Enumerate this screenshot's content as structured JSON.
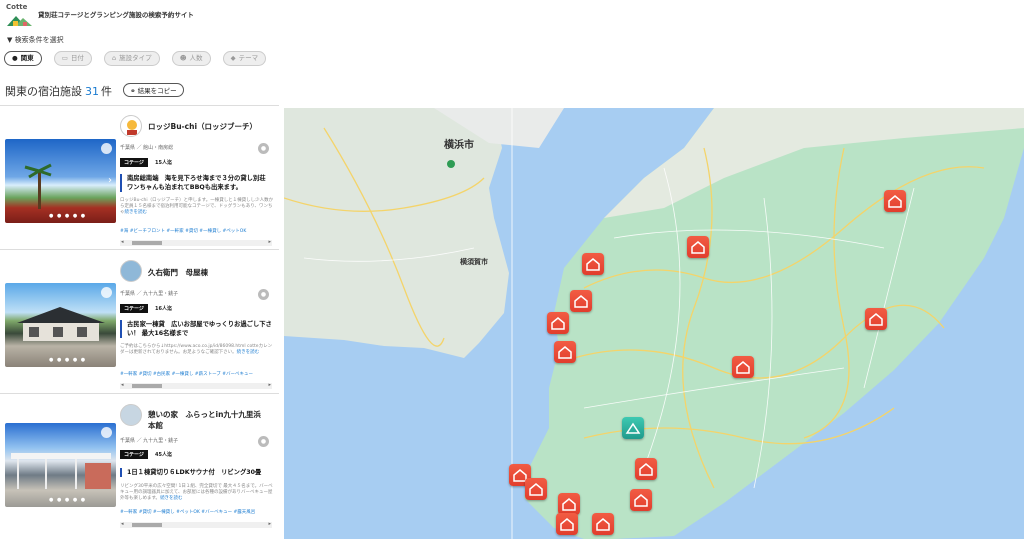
{
  "header": {
    "logo_text": "Cotte",
    "tagline": "貸別荘コテージとグランピング施設の検索予約サイト"
  },
  "filter_label": "検索条件を選択",
  "filters": [
    {
      "label": "関東",
      "icon": "location-pin-icon",
      "active": true
    },
    {
      "label": "日付",
      "icon": "calendar-icon",
      "active": false
    },
    {
      "label": "施設タイプ",
      "icon": "house-icon",
      "active": false
    },
    {
      "label": "人数",
      "icon": "people-icon",
      "active": false
    },
    {
      "label": "テーマ",
      "icon": "tag-icon",
      "active": false
    }
  ],
  "results": {
    "title": "関東の宿泊施設",
    "count": "31",
    "unit": "件",
    "copy_button": "結果をコピー"
  },
  "listings": [
    {
      "name": "ロッジBu-chi（ロッジブーチ）",
      "location": "千葉県 ／ 館山・南房総",
      "type": "コテージ",
      "capacity": "15人迄",
      "headline": "南房総南端　海を見下ろせ海まで３分の貸し別荘　ワンちゃんも泊まれてBBQも出来ます。",
      "description": "ロッジBu-chi（ロッジブーチ）と申します。一棟貸しと１棟貸しし少人数から定員１５名様まで宿泊利用可能なコテージで、ドッグランもあり、ワンちゃ",
      "more": "続きを読む",
      "tags": "#海 #ビーチフロント #一軒家 #貸切 #一棟貸し #ペットOK"
    },
    {
      "name": "久右衛門　母屋棟",
      "location": "千葉県 ／ 九十九里・銚子",
      "type": "コテージ",
      "capacity": "16人迄",
      "headline": "古民家一棟貸　広いお部屋でゆっくりお過ごし下さい！ 最大16名様まで",
      "description": "ご予約はこちらから↓https://www.aco.co.jp/id/86098.html cotteカレンダーは更新されておりません。お足ようなご確認下さい。",
      "more": "続きを読む",
      "tags": "#一軒家 #貸切 #古民家 #一棟貸し #薪ストーブ #バーベキュー"
    },
    {
      "name": "憩いの家　ふらっとin九十九里浜　本館",
      "location": "千葉県 ／ 九十九里・銚子",
      "type": "コテージ",
      "capacity": "45人迄",
      "headline": "1日１棟貸切り６LDKサウナ付　リビング30畳",
      "description": "リビング30平米の広々空間! 1日１組、完全貸切で 最大４５名まで。バーベキュー用の調理器具に加えて、お部屋には各種の設備がありバーベキュー屋外等も楽しめます。",
      "more": "続きを読む",
      "tags": "#一軒家 #貸切 #一棟貸し #ペットOK #バーベキュー #露天風呂"
    }
  ],
  "map": {
    "labels": {
      "yokohama": "横浜市",
      "yokosuka": "横須賀市"
    },
    "colors": {
      "sea": "#a7cdf2",
      "land": "#b9e3c6",
      "urban": "#e9ebea",
      "marker": "#e8452f",
      "highlight": "#2fb6a3"
    }
  }
}
